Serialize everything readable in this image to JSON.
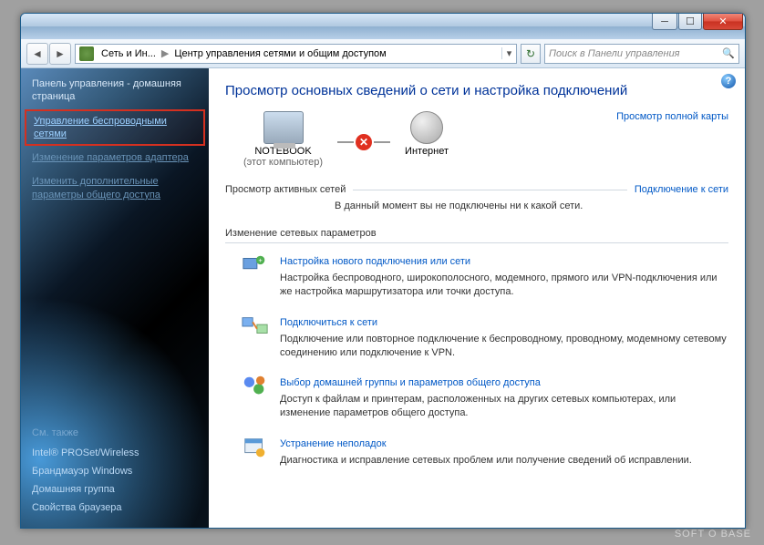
{
  "breadcrumb": {
    "seg1": "Сеть и Ин...",
    "seg2": "Центр управления сетями и общим доступом"
  },
  "search": {
    "placeholder": "Поиск в Панели управления"
  },
  "sidebar": {
    "home": "Панель управления - домашняя страница",
    "links": [
      "Управление беспроводными сетями",
      "Изменение параметров адаптера",
      "Изменить дополнительные параметры общего доступа"
    ],
    "see_also_hdr": "См. также",
    "see_also": [
      "Intel® PROSet/Wireless",
      "Брандмауэр Windows",
      "Домашняя группа",
      "Свойства браузера"
    ]
  },
  "main": {
    "title": "Просмотр основных сведений о сети и настройка подключений",
    "node_pc": "NOTEBOOK",
    "node_pc_sub": "(этот компьютер)",
    "node_net": "Интернет",
    "viewmap": "Просмотр полной карты",
    "active_hdr": "Просмотр активных сетей",
    "active_connect": "Подключение к сети",
    "active_msg": "В данный момент вы не подключены ни к какой сети.",
    "settings_hdr": "Изменение сетевых параметров",
    "items": [
      {
        "title": "Настройка нового подключения или сети",
        "desc": "Настройка беспроводного, широкополосного, модемного, прямого или VPN-подключения или же настройка маршрутизатора или точки доступа."
      },
      {
        "title": "Подключиться к сети",
        "desc": "Подключение или повторное подключение к беспроводному, проводному, модемному сетевому соединению или подключение к VPN."
      },
      {
        "title": "Выбор домашней группы и параметров общего доступа",
        "desc": "Доступ к файлам и принтерам, расположенных на других сетевых компьютерах, или изменение параметров общего доступа."
      },
      {
        "title": "Устранение неполадок",
        "desc": "Диагностика и исправление сетевых проблем или получение сведений об исправлении."
      }
    ]
  },
  "watermark": "SOFT O BASE"
}
